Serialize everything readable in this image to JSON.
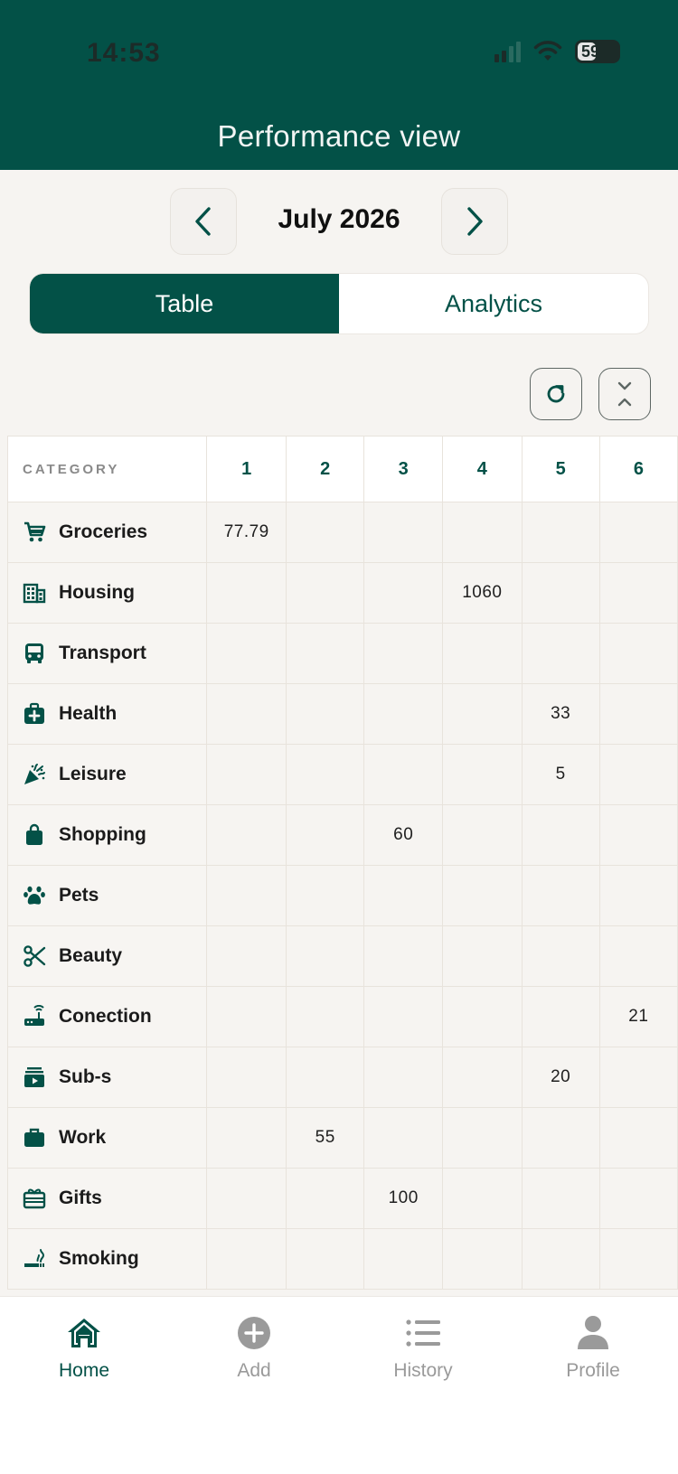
{
  "status_bar": {
    "time": "14:53",
    "battery": "59"
  },
  "header": {
    "title": "Performance view"
  },
  "month_nav": {
    "label": "July 2026"
  },
  "view_toggle": {
    "table_label": "Table",
    "analytics_label": "Analytics"
  },
  "table": {
    "category_header": "CATEGORY",
    "days": [
      "1",
      "2",
      "3",
      "4",
      "5",
      "6"
    ],
    "rows": [
      {
        "label": "Groceries",
        "icon": "cart-icon",
        "values": [
          "77.79",
          "",
          "",
          "",
          "",
          ""
        ]
      },
      {
        "label": "Housing",
        "icon": "building-icon",
        "values": [
          "",
          "",
          "",
          "1060",
          "",
          ""
        ]
      },
      {
        "label": "Transport",
        "icon": "bus-icon",
        "values": [
          "",
          "",
          "",
          "",
          "",
          ""
        ]
      },
      {
        "label": "Health",
        "icon": "medical-kit-icon",
        "values": [
          "",
          "",
          "",
          "",
          "33",
          ""
        ]
      },
      {
        "label": "Leisure",
        "icon": "party-popper-icon",
        "values": [
          "",
          "",
          "",
          "",
          "5",
          ""
        ]
      },
      {
        "label": "Shopping",
        "icon": "shopping-bag-icon",
        "values": [
          "",
          "",
          "60",
          "",
          "",
          ""
        ]
      },
      {
        "label": "Pets",
        "icon": "paw-icon",
        "values": [
          "",
          "",
          "",
          "",
          "",
          ""
        ]
      },
      {
        "label": "Beauty",
        "icon": "scissors-icon",
        "values": [
          "",
          "",
          "",
          "",
          "",
          ""
        ]
      },
      {
        "label": "Conection",
        "icon": "router-icon",
        "values": [
          "",
          "",
          "",
          "",
          "",
          "21"
        ]
      },
      {
        "label": "Sub-s",
        "icon": "subscriptions-icon",
        "values": [
          "",
          "",
          "",
          "",
          "20",
          ""
        ]
      },
      {
        "label": "Work",
        "icon": "briefcase-icon",
        "values": [
          "",
          "55",
          "",
          "",
          "",
          ""
        ]
      },
      {
        "label": "Gifts",
        "icon": "gift-card-icon",
        "values": [
          "",
          "",
          "100",
          "",
          "",
          ""
        ]
      },
      {
        "label": "Smoking",
        "icon": "smoking-icon",
        "values": [
          "",
          "",
          "",
          "",
          "",
          ""
        ]
      }
    ]
  },
  "tabbar": {
    "home": "Home",
    "add": "Add",
    "history": "History",
    "profile": "Profile"
  },
  "colors": {
    "primary": "#035147",
    "background": "#f6f4f1",
    "muted": "#9a9a9a"
  }
}
